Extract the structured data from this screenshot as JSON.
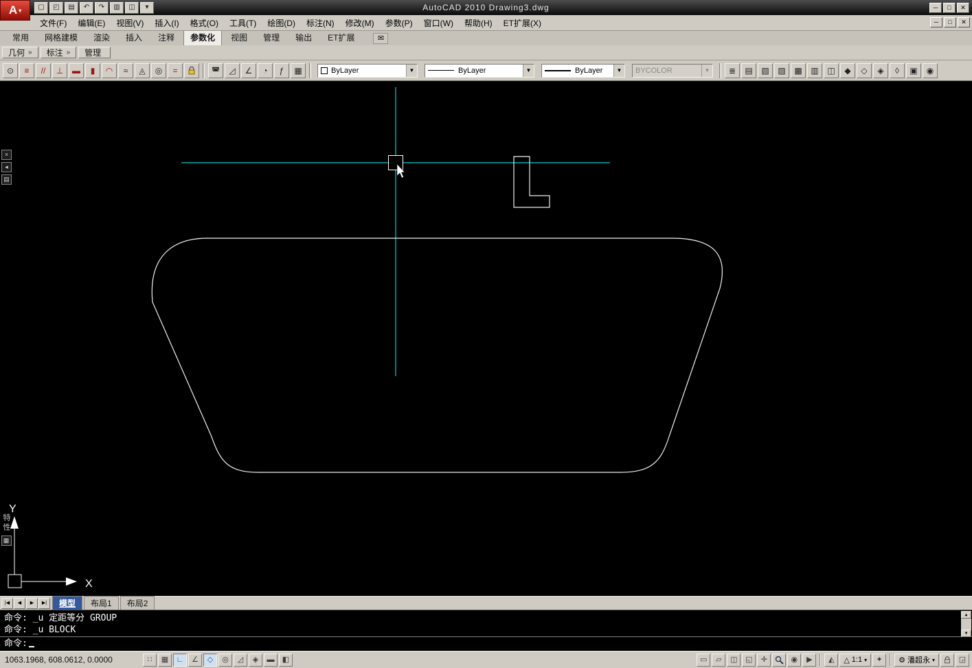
{
  "titlebar": {
    "title": "AutoCAD 2010  Drawing3.dwg",
    "logo_letter": "A",
    "logo_arrow": "▾",
    "qat": [
      {
        "name": "new-icon",
        "glyph": "▢"
      },
      {
        "name": "open-icon",
        "glyph": "◰"
      },
      {
        "name": "save-icon",
        "glyph": "▤"
      },
      {
        "name": "undo-icon",
        "glyph": "↶"
      },
      {
        "name": "redo-icon",
        "glyph": "↷"
      },
      {
        "name": "plot-icon",
        "glyph": "▥"
      },
      {
        "name": "plot-preview-icon",
        "glyph": "◫"
      },
      {
        "name": "menu-dropdown-icon",
        "glyph": "▾"
      }
    ],
    "window_controls": [
      {
        "name": "minimize-button",
        "glyph": "─"
      },
      {
        "name": "restore-button",
        "glyph": "□"
      },
      {
        "name": "close-button",
        "glyph": "✕"
      }
    ]
  },
  "menubar": {
    "items": [
      "文件(F)",
      "编辑(E)",
      "视图(V)",
      "插入(I)",
      "格式(O)",
      "工具(T)",
      "绘图(D)",
      "标注(N)",
      "修改(M)",
      "参数(P)",
      "窗口(W)",
      "帮助(H)",
      "ET扩展(X)"
    ],
    "mdi_controls": [
      {
        "name": "mdi-minimize-button",
        "glyph": "─"
      },
      {
        "name": "mdi-restore-button",
        "glyph": "□"
      },
      {
        "name": "mdi-close-button",
        "glyph": "✕"
      }
    ]
  },
  "ribbon": {
    "tabs": [
      {
        "label": "常用",
        "cls": ""
      },
      {
        "label": "网格建模",
        "cls": ""
      },
      {
        "label": "渲染",
        "cls": ""
      },
      {
        "label": "插入",
        "cls": ""
      },
      {
        "label": "注释",
        "cls": ""
      },
      {
        "label": "参数化",
        "cls": "active"
      },
      {
        "label": "视图",
        "cls": ""
      },
      {
        "label": "管理",
        "cls": ""
      },
      {
        "label": "输出",
        "cls": ""
      },
      {
        "label": "ET扩展",
        "cls": ""
      }
    ],
    "mail_icon": "✉"
  },
  "panel_tabs": [
    {
      "name": "panel-tab-geometry",
      "label": "几何",
      "chevron": "»"
    },
    {
      "name": "panel-tab-dimension",
      "label": "标注",
      "chevron": "»"
    },
    {
      "name": "panel-tab-manage",
      "label": "管理",
      "chevron": ""
    }
  ],
  "toolbar": {
    "geo_icons": [
      {
        "name": "coincident-constraint-icon",
        "glyph": "⊙",
        "cls": ""
      },
      {
        "name": "collinear-constraint-icon",
        "glyph": "≡",
        "cls": "red"
      },
      {
        "name": "parallel-constraint-icon",
        "glyph": "//",
        "cls": "red"
      },
      {
        "name": "perpendicular-constraint-icon",
        "glyph": "⊥",
        "cls": "red"
      },
      {
        "name": "horizontal-constraint-icon",
        "glyph": "▬",
        "cls": "red"
      },
      {
        "name": "vertical-constraint-icon",
        "glyph": "▮",
        "cls": "red"
      },
      {
        "name": "tangent-constraint-icon",
        "glyph": "◠",
        "cls": "red"
      },
      {
        "name": "smooth-constraint-icon",
        "glyph": "≈",
        "cls": ""
      },
      {
        "name": "symmetric-constraint-icon",
        "glyph": "◬",
        "cls": ""
      },
      {
        "name": "concentric-constraint-icon",
        "glyph": "◎",
        "cls": ""
      },
      {
        "name": "equal-constraint-icon",
        "glyph": "=",
        "cls": "red"
      }
    ],
    "dim_icons": [
      {
        "name": "auto-constrain-icon",
        "glyph": "◚",
        "cls": ""
      },
      {
        "name": "aligned-constraint-icon",
        "glyph": "◿",
        "cls": ""
      },
      {
        "name": "angular-constraint-icon",
        "glyph": "∠",
        "cls": ""
      },
      {
        "name": "radius-constraint-icon",
        "glyph": "◔",
        "cls": ""
      },
      {
        "name": "parameters-manager-icon",
        "glyph": "ƒ",
        "cls": ""
      },
      {
        "name": "constraint-settings-icon",
        "glyph": "▦",
        "cls": ""
      }
    ],
    "color_value": "ByLayer",
    "linetype_value": "ByLayer",
    "lineweight_value": "ByLayer",
    "plotstyle_value": "BYCOLOR",
    "dropdown_arrow": "▼",
    "right_icons": [
      {
        "name": "layer-properties-manager-icon",
        "glyph": "≣"
      },
      {
        "name": "layer-states-manager-icon",
        "glyph": "▤"
      },
      {
        "name": "layer-isolate-icon",
        "glyph": "▧"
      },
      {
        "name": "layer-unisolate-icon",
        "glyph": "▨"
      },
      {
        "name": "layer-freeze-icon",
        "glyph": "▩"
      },
      {
        "name": "layer-off-icon",
        "glyph": "▥"
      },
      {
        "name": "layer-lock-icon",
        "glyph": "◫"
      },
      {
        "name": "make-object-layer-current-icon",
        "glyph": "◆"
      },
      {
        "name": "layer-match-icon",
        "glyph": "◇"
      },
      {
        "name": "change-to-current-layer-icon",
        "glyph": "◈"
      },
      {
        "name": "copy-objects-to-layer-icon",
        "glyph": "◊"
      },
      {
        "name": "layer-walk-icon",
        "glyph": "▣"
      },
      {
        "name": "match-properties-icon",
        "glyph": "◉"
      }
    ]
  },
  "canvas": {
    "palette": {
      "close_glyph": "×",
      "autohide_glyph": "◂",
      "menu_glyph": "▤",
      "label": "特性",
      "grid_glyph": "▦"
    },
    "ucs": {
      "x_label": "X",
      "y_label": "Y"
    }
  },
  "layout_bar": {
    "nav": [
      {
        "name": "first-tab-button",
        "glyph": "|◀"
      },
      {
        "name": "prev-tab-button",
        "glyph": "◀"
      },
      {
        "name": "next-tab-button",
        "glyph": "▶"
      },
      {
        "name": "last-tab-button",
        "glyph": "▶|"
      }
    ],
    "tabs": [
      {
        "label": "模型",
        "cls": "active"
      },
      {
        "label": "布局1",
        "cls": ""
      },
      {
        "label": "布局2",
        "cls": ""
      }
    ]
  },
  "command": {
    "history": [
      "命令: _u 定距等分  GROUP",
      "命令: _u BLOCK"
    ],
    "prompt": "命令:",
    "scroll_up": "▲",
    "scroll_down": "▼"
  },
  "statusbar": {
    "coords": "1063.1968, 608.0612, 0.0000",
    "toggles": [
      {
        "name": "snap-toggle",
        "glyph": "∷",
        "cls": ""
      },
      {
        "name": "grid-toggle",
        "glyph": "▦",
        "cls": ""
      },
      {
        "name": "ortho-toggle",
        "glyph": "∟",
        "cls": "pressed"
      },
      {
        "name": "polar-toggle",
        "glyph": "∠",
        "cls": ""
      },
      {
        "name": "osnap-toggle",
        "glyph": "◇",
        "cls": "pressed"
      },
      {
        "name": "otrack-toggle",
        "glyph": "◎",
        "cls": ""
      },
      {
        "name": "ducs-toggle",
        "glyph": "◿",
        "cls": ""
      },
      {
        "name": "dyn-toggle",
        "glyph": "◈",
        "cls": ""
      },
      {
        "name": "lwt-toggle",
        "glyph": "▬",
        "cls": ""
      },
      {
        "name": "qp-toggle",
        "glyph": "◧",
        "cls": ""
      }
    ],
    "right": {
      "model_glyph": "▭",
      "layout_glyph": "▱",
      "qv_layouts_glyph": "◫",
      "qv_drawings_glyph": "◱",
      "pan_glyph": "✛",
      "wheel_glyph": "◉",
      "motion_glyph": "▶",
      "ann_vis_glyph": "◭",
      "scale_icon": "△",
      "scale_value": "1:1",
      "dropdown": "▾",
      "ann_auto_glyph": "✦",
      "gear": "⚙",
      "workspace": "潘超永",
      "clean_glyph": "◲"
    }
  }
}
